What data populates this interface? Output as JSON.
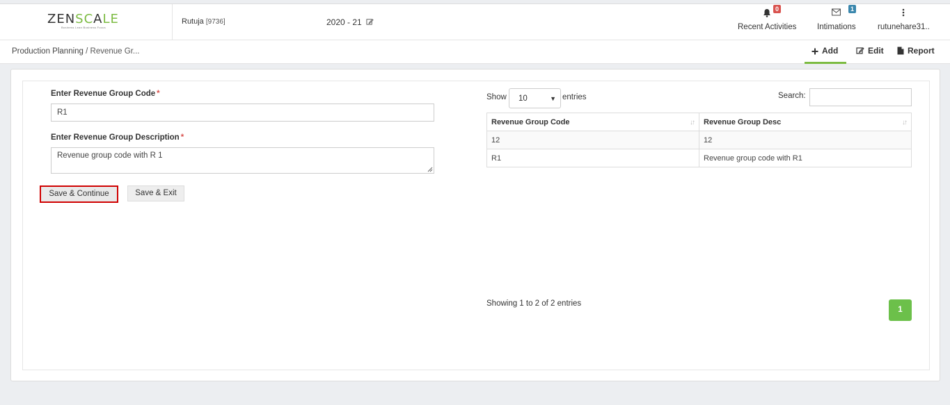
{
  "brand": {
    "logo_part1": "ZEN",
    "logo_part2": "SC",
    "logo_part3": "A",
    "logo_part4": "LE",
    "tagline": "Business Lean Business Focus"
  },
  "header": {
    "user_name": "Rutuja",
    "user_id": "[9736]",
    "financial_year": "2020 - 21",
    "recent_activities": {
      "label": "Recent Activities",
      "badge": "0",
      "icon": "bell-icon"
    },
    "intimations": {
      "label": "Intimations",
      "badge": "1",
      "icon": "envelope-icon"
    },
    "account": {
      "label": "rutunehare31..",
      "icon": "more-vertical-icon"
    }
  },
  "breadcrumb": {
    "parent": "Production Planning",
    "current": "/ Revenue Gr..."
  },
  "actions": {
    "add": "Add",
    "edit": "Edit",
    "report": "Report"
  },
  "form": {
    "code_label": "Enter Revenue Group Code",
    "code_value": "R1",
    "desc_label": "Enter Revenue Group Description",
    "desc_value": "Revenue group code with R 1",
    "required_mark": "*",
    "save_continue": "Save & Continue",
    "save_exit": "Save & Exit"
  },
  "table": {
    "show_label": "Show",
    "page_size": "10",
    "entries_label": "entries",
    "search_label": "Search:",
    "columns": [
      "Revenue Group Code",
      "Revenue Group Desc"
    ],
    "rows": [
      [
        "12",
        "12"
      ],
      [
        "R1",
        "Revenue group code with R1"
      ]
    ],
    "info": "Showing 1 to 2 of 2 entries",
    "current_page": "1"
  },
  "colors": {
    "accent": "#7cbb42",
    "highlight": "#d00000",
    "page_button": "#6cc04a"
  }
}
